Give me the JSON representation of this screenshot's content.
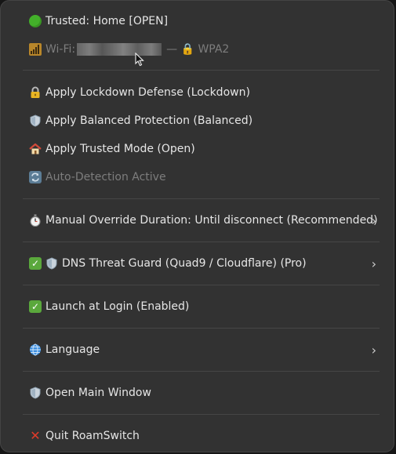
{
  "status": {
    "trusted": "Trusted: Home [OPEN]",
    "wifi_prefix": "Wi-Fi:",
    "wifi_suffix": "— 🔒 WPA2"
  },
  "modes": {
    "lockdown": "Apply Lockdown Defense (Lockdown)",
    "balanced": "Apply Balanced Protection (Balanced)",
    "trusted": "Apply Trusted Mode (Open)",
    "auto_detect": "Auto-Detection Active"
  },
  "override": {
    "label": "Manual Override Duration: Until disconnect (Recommended)"
  },
  "dns": {
    "label": "DNS Threat Guard (Quad9 / Cloudflare) (Pro)"
  },
  "login": {
    "label": "Launch at Login (Enabled)"
  },
  "language": {
    "label": "Language"
  },
  "main_window": {
    "label": "Open Main Window"
  },
  "quit": {
    "label": "Quit RoamSwitch"
  },
  "icons": {
    "trusted": "green-circle-icon",
    "wifi": "signal-bars-icon",
    "lockdown": "lock-icon",
    "balanced": "shield-icon",
    "trusted_mode": "house-icon",
    "auto_detect": "refresh-icon",
    "override": "stopwatch-icon",
    "dns": "check-icon",
    "login": "check-icon",
    "language": "globe-icon",
    "main_window": "shield-icon",
    "quit": "cross-icon",
    "submenu": "chevron-right-icon"
  },
  "colors": {
    "menu_bg": "#323232",
    "text": "#e6e6e6",
    "disabled_text": "#7d7d7d",
    "separator": "#464646"
  }
}
